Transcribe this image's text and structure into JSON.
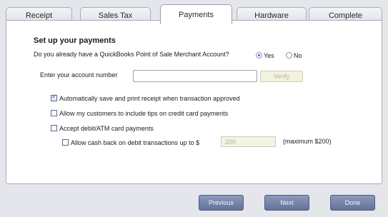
{
  "tabs": [
    {
      "label": "Receipt"
    },
    {
      "label": "Sales Tax"
    },
    {
      "label": "Payments"
    },
    {
      "label": "Hardware"
    },
    {
      "label": "Complete"
    }
  ],
  "active_tab": "Payments",
  "panel": {
    "title": "Set up your payments",
    "question": "Do you already have a QuickBooks Point of Sale Merchant Account?",
    "yes_label": "Yes",
    "no_label": "No",
    "selected": "Yes",
    "account_label": "Enter your account number",
    "account_value": "",
    "verify_label": "Verify",
    "options": [
      {
        "label": "Automatically save and print receipt when transaction approved",
        "checked": true
      },
      {
        "label": "Allow my customers to include tips on credit card payments",
        "checked": false
      },
      {
        "label": "Accept debit/ATM card payments",
        "checked": false
      }
    ],
    "cashback_label": "Allow cash back on debit transactions up to $",
    "cashback_checked": false,
    "cashback_value": "200",
    "cashback_max": "(maximum $200)"
  },
  "buttons": {
    "previous": "Previous",
    "next": "Next",
    "done": "Done"
  }
}
